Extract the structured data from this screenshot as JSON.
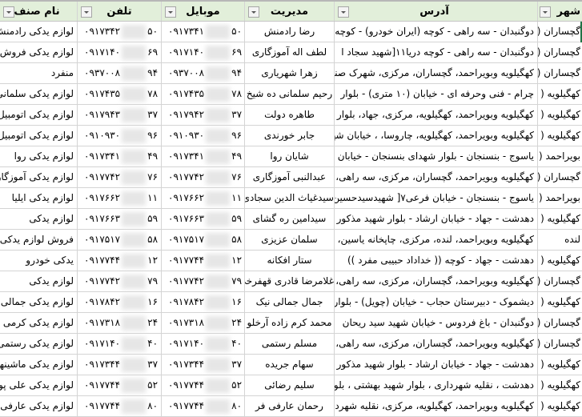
{
  "headers": {
    "city": "شهر",
    "address": "آدرس",
    "manager": "مدیریت",
    "mobile": "موبایل",
    "phone": "تلفن",
    "guild": "نام صنف"
  },
  "rows": [
    {
      "city": "گچساران (",
      "address": "دوگنبدان - سه راهی - کوچه (ایران خودرو) - کوچه",
      "manager": "رضا رادمنش",
      "mobile_pre": "۰۹۱۷۳۴۱",
      "mobile_suf": "۵۰",
      "phone_pre": "۰۹۱۷۳۴۲",
      "phone_suf": "۵۰",
      "guild": "لوازم یدکی رادمنش"
    },
    {
      "city": "گچساران (",
      "address": "دوگنبدان - سه راهی - کوچه دریا۱۱[شهید سجاد ا",
      "manager": "لطف اله آموزگاری",
      "mobile_pre": "۰۹۱۷۱۴۰",
      "mobile_suf": "۶۹",
      "phone_pre": "۰۹۱۷۱۴۰",
      "phone_suf": "۶۹",
      "guild": "لوازم یدکی فروش"
    },
    {
      "city": "گچساران (",
      "address": "کهگیلویه وبویراحمد، گچساران، مرکزی، شهرک صنعتی",
      "manager": "زهرا شهریاری",
      "mobile_pre": "۰۹۳۷۰۰۸",
      "mobile_suf": "۹۴",
      "phone_pre": "۰۹۳۷۰۰۸",
      "phone_suf": "۹۴",
      "guild": "منفرد"
    },
    {
      "city": "کهگیلویه (",
      "address": "چرام - فنی وحرفه ای - خیابان (۱۰ متری) - بلوار",
      "manager": "رحیم سلمانی ده شیخ",
      "mobile_pre": "۰۹۱۷۴۳۵",
      "mobile_suf": "۷۸",
      "phone_pre": "۰۹۱۷۴۳۵",
      "phone_suf": "۷۸",
      "guild": "لوازم یدکی سلمانی"
    },
    {
      "city": "کهگیلویه (",
      "address": "کهگیلویه وبویراحمد، کهگیلویه، مرکزی، جهاد، بلوار",
      "manager": "طاهره دولت",
      "mobile_pre": "۰۹۱۷۹۴۲",
      "mobile_suf": "۳۷",
      "phone_pre": "۰۹۱۷۹۴۳",
      "phone_suf": "۳۷",
      "guild": "لوازم یدکی اتومبیل"
    },
    {
      "city": "کهگیلویه (",
      "address": "کهگیلویه وبویراحمد، کهگیلویه، چاروسا، ، خیابان شهید",
      "manager": "جابر خورندی",
      "mobile_pre": "۰۹۱۰۹۳۰",
      "mobile_suf": "۹۶",
      "phone_pre": "۰۹۱۰۹۳۰",
      "phone_suf": "۹۶",
      "guild": "لوازم یدکی اتومبیل"
    },
    {
      "city": "بویراحمد (",
      "address": "یاسوج - بنسنجان - بلوار شهدای بنسنجان - خیابان",
      "manager": "شایان روا",
      "mobile_pre": "۰۹۱۷۳۴۱",
      "mobile_suf": "۴۹",
      "phone_pre": "۰۹۱۷۳۴۱",
      "phone_suf": "۴۹",
      "guild": "لوازم یدکی روا"
    },
    {
      "city": "گچساران (",
      "address": "کهگیلویه وبویراحمد، گچساران، مرکزی، سه راهی،",
      "manager": "عبدالنبی آموزگاری",
      "mobile_pre": "۰۹۱۷۷۴۲",
      "mobile_suf": "۷۶",
      "phone_pre": "۰۹۱۷۷۴۲",
      "phone_suf": "۷۶",
      "guild": "لوازم یدکی  آموزگاری"
    },
    {
      "city": "بویراحمد (",
      "address": "یاسوج - بنسنجان - خیابان فرعی۷[ شهیدسیدحسین",
      "manager": "سیدغیاث الدین سجادی",
      "mobile_pre": "۰۹۱۷۶۶۲",
      "mobile_suf": "۱۱",
      "phone_pre": "۰۹۱۷۶۶۲",
      "phone_suf": "۱۱",
      "guild": "لوازم یدکی ایلیا"
    },
    {
      "city": "کهگیلویه (",
      "address": "دهدشت - جهاد - خیابان ارشاد - بلوار شهید مذکور",
      "manager": "سیدامین ره گشای",
      "mobile_pre": "۰۹۱۷۶۶۳",
      "mobile_suf": "۵۹",
      "phone_pre": "۰۹۱۷۶۶۳",
      "phone_suf": "۵۹",
      "guild": "لوازم یدکی"
    },
    {
      "city": "لنده",
      "address": "کهگیلویه وبویراحمد، لنده، مرکزی، چاپخانه یاسین،",
      "manager": "سلمان عزیزی",
      "mobile_pre": "۰۹۱۷۵۱۷",
      "mobile_suf": "۵۸",
      "phone_pre": "۰۹۱۷۵۱۷",
      "phone_suf": "۵۸",
      "guild": "فروش لوازم یدکی"
    },
    {
      "city": "کهگیلویه (",
      "address": "دهدشت - جهاد - کوچه (( خداداد حبیبی مفرد ))",
      "manager": "ستار افکانه",
      "mobile_pre": "۰۹۱۷۷۴۴",
      "mobile_suf": "۱۲",
      "phone_pre": "۰۹۱۷۷۴۴",
      "phone_suf": "۱۲",
      "guild": "یدکی خودرو"
    },
    {
      "city": "گچساران (",
      "address": "کهگیلویه وبویراحمد، گچساران، مرکزی، سه راهی،",
      "manager": "غلامرضا قادری قهفرخی",
      "mobile_pre": "۰۹۱۷۷۴۲",
      "mobile_suf": "۷۹",
      "phone_pre": "۰۹۱۷۷۴۲",
      "phone_suf": "۷۹",
      "guild": "لوازم یدکی"
    },
    {
      "city": "کهگیلویه (",
      "address": "دیشموک - دبیرستان حجاب - خیابان (چویل) - بلوار",
      "manager": "جمال جمالی نیک",
      "mobile_pre": "۰۹۱۷۸۴۲",
      "mobile_suf": "۱۶",
      "phone_pre": "۰۹۱۷۸۴۲",
      "phone_suf": "۱۶",
      "guild": "لوازم یدکی جمالی"
    },
    {
      "city": "گچساران (",
      "address": "دوگنبدان - باغ فردوس - خیابان شهید سید ریحان",
      "manager": "محمد کرم زاده آرخلو",
      "mobile_pre": "۰۹۱۷۳۱۸",
      "mobile_suf": "۲۴",
      "phone_pre": "۰۹۱۷۳۱۸",
      "phone_suf": "۲۴",
      "guild": "لوازم یدکی کرمی"
    },
    {
      "city": "گچساران (",
      "address": "کهگیلویه وبویراحمد، گچساران، مرکزی، سه راهی،",
      "manager": "مسلم رستمی",
      "mobile_pre": "۰۹۱۷۱۴۰",
      "mobile_suf": "۴۰",
      "phone_pre": "۰۹۱۷۱۴۰",
      "phone_suf": "۴۰",
      "guild": "لوازم یدکی رستمی"
    },
    {
      "city": "کهگیلویه (",
      "address": "دهدشت - جهاد - خیابان ارشاد - بلوار شهید مذکور",
      "manager": "سهام جریده",
      "mobile_pre": "۰۹۱۷۳۴۴",
      "mobile_suf": "۳۷",
      "phone_pre": "۰۹۱۷۳۴۴",
      "phone_suf": "۳۷",
      "guild": "لوازم یدکی ماشینها"
    },
    {
      "city": "کهگیلویه (",
      "address": "دهدشت ، نقلیه شهرداری ، بلوار شهید بهشتی ، بلوار",
      "manager": "سلیم رضائی",
      "mobile_pre": "۰۹۱۷۷۴۴",
      "mobile_suf": "۵۲",
      "phone_pre": "۰۹۱۷۷۴۴",
      "phone_suf": "۵۲",
      "guild": "لوازم یدکی علی پور"
    },
    {
      "city": "کهگیلویه (",
      "address": "کهگیلویه وبویراحمد، کهگیلویه، مرکزی، نقلیه شهرداری",
      "manager": "رحمان عارفی فر",
      "mobile_pre": "۰۹۱۷۷۴۴",
      "mobile_suf": "۸۰",
      "phone_pre": "۰۹۱۷۷۴۴",
      "phone_suf": "۸۰",
      "guild": "لوازم یدکی عارفی"
    }
  ],
  "colors": {
    "header_bg": "#e2efda",
    "gridline": "#d4d4d4",
    "selection": "#217346"
  }
}
